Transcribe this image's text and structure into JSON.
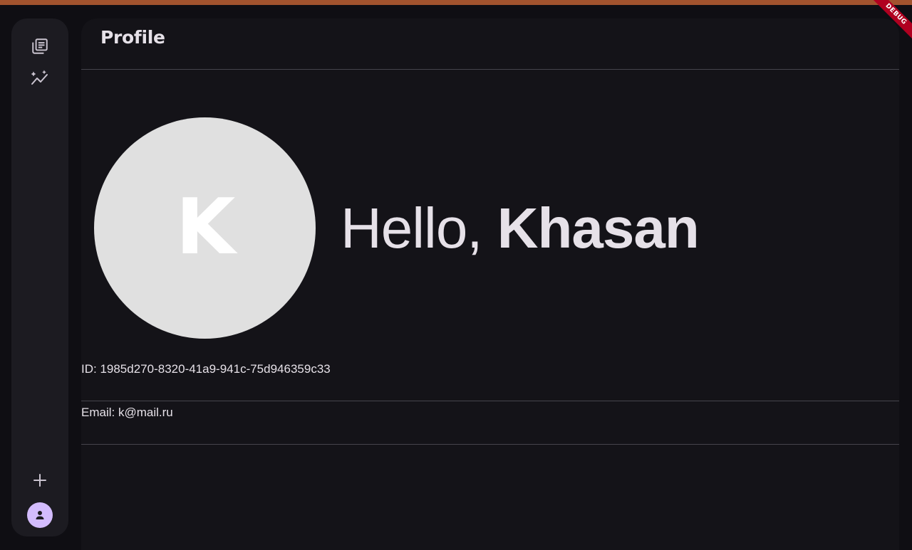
{
  "app": {
    "debug_label": "DEBUG"
  },
  "rail": {
    "items": [
      {
        "icon": "library-icon"
      },
      {
        "icon": "analytics-icon"
      }
    ],
    "add_icon": "plus-icon",
    "profile_icon": "person-icon"
  },
  "header": {
    "title": "Profile"
  },
  "profile": {
    "avatar_initial": "K",
    "greeting_prefix": "Hello, ",
    "name": "Khasan",
    "id_text": "ID: 1985d270-8320-41a9-941c-75d946359c33",
    "email_text": "Email: k@mail.ru"
  },
  "colors": {
    "background": "#0f0e13",
    "panel": "#141318",
    "rail": "#1c1b21",
    "accent": "#d3bcfd",
    "avatar": "#e0e0e0",
    "topbar": "#a2532e",
    "debug": "#b00020"
  }
}
